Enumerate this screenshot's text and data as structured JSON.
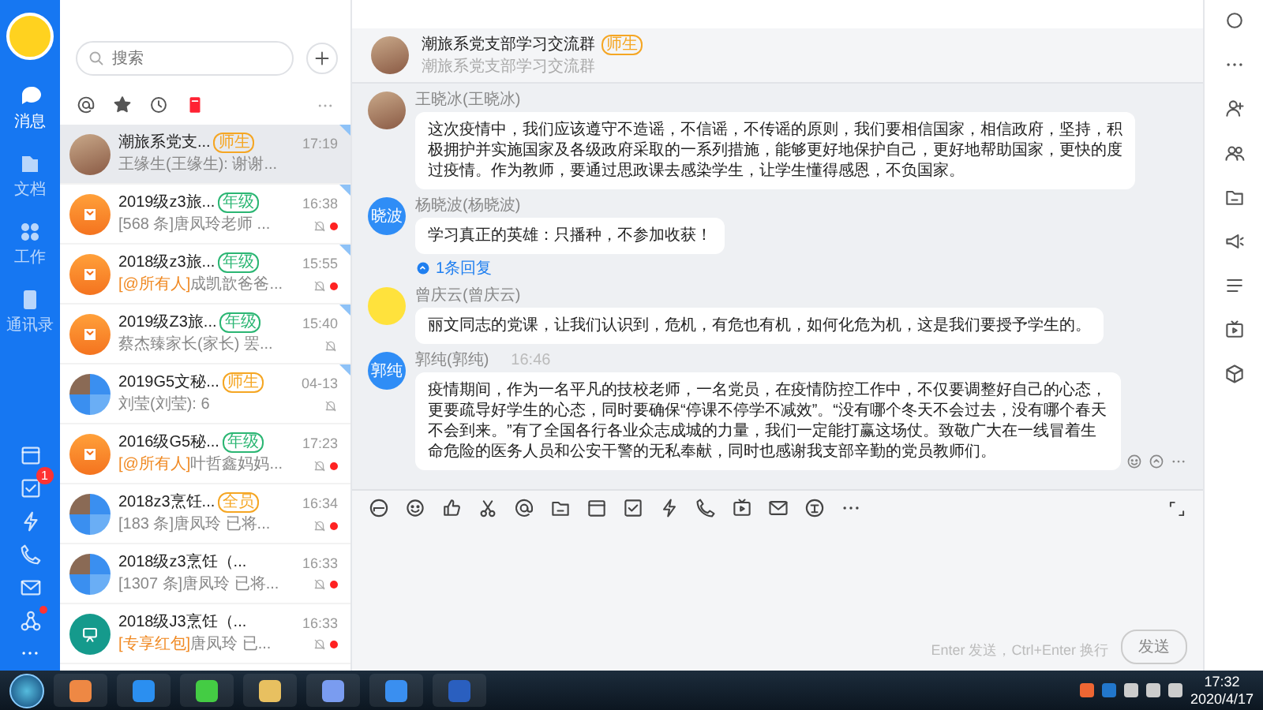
{
  "rail": {
    "items": [
      {
        "label": "消息",
        "selected": true
      },
      {
        "label": "文档",
        "selected": false
      },
      {
        "label": "工作",
        "selected": false
      },
      {
        "label": "通讯录",
        "selected": false
      }
    ],
    "todo_badge": "1"
  },
  "chat_list": {
    "search": {
      "placeholder": "搜索"
    },
    "conversations": [
      {
        "name": "潮旅系党支...",
        "tag": {
          "text": "师生",
          "color": "#f5a623"
        },
        "time": "17:19",
        "preview": "王缘生(王缘生): 谢谢...",
        "avatar": {
          "kind": "photo"
        },
        "pinned": true,
        "muted": false,
        "unread": false,
        "selected": true
      },
      {
        "name": "2019级z3旅...",
        "tag": {
          "text": "年级",
          "color": "#2bb673"
        },
        "time": "16:38",
        "preview": "[568 条]唐凤玲老师 ...",
        "avatar": {
          "kind": "book"
        },
        "pinned": true,
        "muted": true,
        "unread": true,
        "selected": false
      },
      {
        "name": "2018级z3旅...",
        "tag": {
          "text": "年级",
          "color": "#2bb673"
        },
        "time": "15:55",
        "prefix": "[@所有人]",
        "preview": "成凯歆爸爸...",
        "avatar": {
          "kind": "book"
        },
        "pinned": true,
        "muted": true,
        "unread": true,
        "selected": false
      },
      {
        "name": "2019级Z3旅...",
        "tag": {
          "text": "年级",
          "color": "#2bb673"
        },
        "time": "15:40",
        "preview": "蔡杰臻家长(家长) 罢...",
        "avatar": {
          "kind": "book"
        },
        "pinned": true,
        "muted": true,
        "unread": false,
        "selected": false
      },
      {
        "name": "2019G5文秘...",
        "tag": {
          "text": "师生",
          "color": "#f5a623"
        },
        "time": "04-13",
        "preview": "刘莹(刘莹): 6",
        "avatar": {
          "kind": "grid"
        },
        "pinned": true,
        "muted": true,
        "unread": false,
        "selected": false
      },
      {
        "name": "2016级G5秘...",
        "tag": {
          "text": "年级",
          "color": "#2bb673"
        },
        "time": "17:23",
        "prefix": "[@所有人]",
        "preview": "叶哲鑫妈妈...",
        "avatar": {
          "kind": "book"
        },
        "pinned": false,
        "muted": true,
        "unread": true,
        "selected": false
      },
      {
        "name": "2018z3烹饪...",
        "tag": {
          "text": "全员",
          "color": "#f5a623"
        },
        "time": "16:34",
        "preview": "[183 条]唐凤玲 已将...",
        "avatar": {
          "kind": "grid"
        },
        "pinned": false,
        "muted": true,
        "unread": true,
        "selected": false
      },
      {
        "name": "2018级z3烹饪（...",
        "time": "16:33",
        "preview": "[1307 条]唐凤玲 已将...",
        "avatar": {
          "kind": "grid"
        },
        "pinned": false,
        "muted": true,
        "unread": true,
        "selected": false
      },
      {
        "name": "2018级J3烹饪（...",
        "time": "16:33",
        "prefix": "[专享红包]",
        "preview": "唐凤玲 已...",
        "avatar": {
          "kind": "board"
        },
        "pinned": false,
        "muted": true,
        "unread": true,
        "selected": false
      }
    ]
  },
  "chat": {
    "title": "潮旅系党支部学习交流群",
    "tag": {
      "text": "师生",
      "color": "#f5a623"
    },
    "subtitle": "潮旅系党支部学习交流群",
    "messages": [
      {
        "sender": "王晓冰(王晓冰)",
        "avatar": {
          "kind": "photo"
        },
        "text": "这次疫情中，我们应该遵守不造谣，不信谣，不传谣的原则，我们要相信国家，相信政府，坚持，积极拥护并实施国家及各级政府采取的一系列措施，能够更好地保护自己，更好地帮助国家，更快的度过疫情。作为教师，要通过思政课去感染学生，让学生懂得感恩，不负国家。"
      },
      {
        "sender": "杨晓波(杨晓波)",
        "avatar": {
          "kind": "text",
          "text": "晓波"
        },
        "text": "学习真正的英雄：只播种，不参加收获！",
        "replies": "1条回复"
      },
      {
        "sender": "曾庆云(曾庆云)",
        "avatar": {
          "kind": "cartoon"
        },
        "text": "丽文同志的党课，让我们认识到，危机，有危也有机，如何化危为机，这是我们要授予学生的。"
      },
      {
        "sender": "郭纯(郭纯)",
        "time": "16:46",
        "avatar": {
          "kind": "text",
          "text": "郭纯"
        },
        "text": "疫情期间，作为一名平凡的技校老师，一名党员，在疫情防控工作中，不仅要调整好自己的心态，更要疏导好学生的心态，同时要确保“停课不停学不减效”。“没有哪个冬天不会过去，没有哪个春天不会到来。”有了全国各行各业众志成城的力量，我们一定能打赢这场仗。致敬广大在一线冒着生命危险的医务人员和公安干警的无私奉献，同时也感谢我支部辛勤的党员教师们。",
        "hover_actions": true
      }
    ],
    "composer": {
      "hint": "Enter 发送，Ctrl+Enter 换行",
      "send": "发送",
      "send_disabled": true
    }
  },
  "taskbar": {
    "time": "17:32",
    "date": "2020/4/17"
  }
}
